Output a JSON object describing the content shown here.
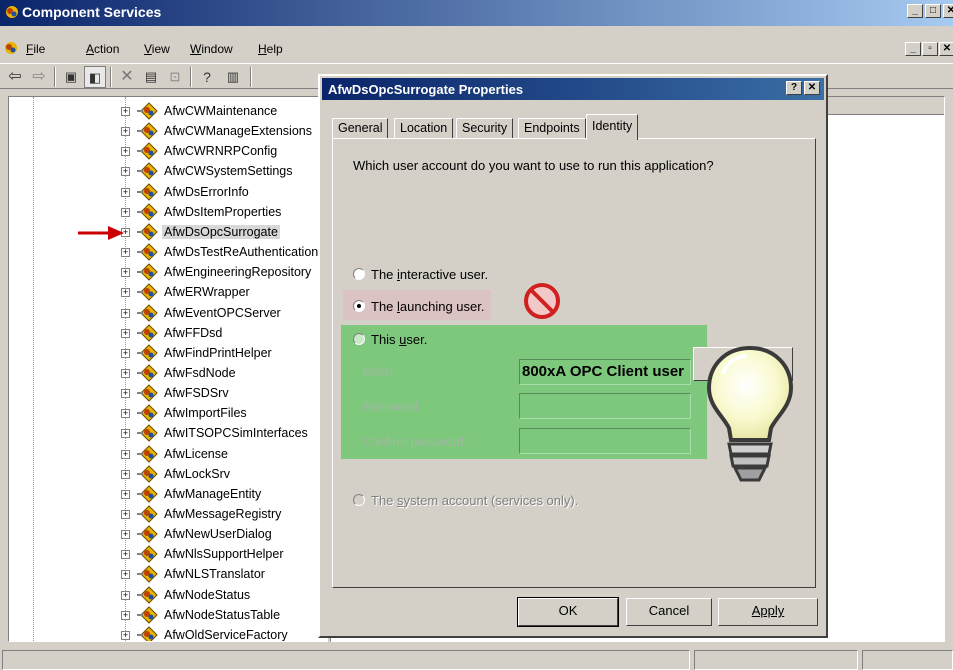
{
  "window": {
    "title": "Component Services",
    "controls": [
      "_",
      "□",
      "✕"
    ]
  },
  "menu": {
    "items": [
      {
        "mnemonic": "F",
        "rest": "ile"
      },
      {
        "mnemonic": "A",
        "rest": "ction"
      },
      {
        "mnemonic": "V",
        "rest": "iew"
      },
      {
        "mnemonic": "W",
        "rest": "indow"
      },
      {
        "mnemonic": "H",
        "rest": "elp"
      }
    ],
    "mdi_controls": [
      "_",
      "▫",
      "✕"
    ]
  },
  "toolbar": {
    "icons": [
      "back-icon",
      "forward-icon",
      "up-folder-icon",
      "show-tree-icon",
      "delete-icon",
      "properties-icon",
      "refresh-icon",
      "help-icon",
      "console-icon"
    ]
  },
  "tree": {
    "items": [
      {
        "label": "AfwCWMaintenance"
      },
      {
        "label": "AfwCWManageExtensions"
      },
      {
        "label": "AfwCWRNRPConfig"
      },
      {
        "label": "AfwCWSystemSettings"
      },
      {
        "label": "AfwDsErrorInfo"
      },
      {
        "label": "AfwDsItemProperties"
      },
      {
        "label": "AfwDsOpcSurrogate"
      },
      {
        "label": "AfwDsTestReAuthentication"
      },
      {
        "label": "AfwEngineeringRepository"
      },
      {
        "label": "AfwERWrapper"
      },
      {
        "label": "AfwEventOPCServer"
      },
      {
        "label": "AfwFFDsd"
      },
      {
        "label": "AfwFindPrintHelper"
      },
      {
        "label": "AfwFsdNode"
      },
      {
        "label": "AfwFSDSrv"
      },
      {
        "label": "AfwImportFiles"
      },
      {
        "label": "AfwITSOPCSimInterfaces"
      },
      {
        "label": "AfwLicense"
      },
      {
        "label": "AfwLockSrv"
      },
      {
        "label": "AfwManageEntity"
      },
      {
        "label": "AfwMessageRegistry"
      },
      {
        "label": "AfwNewUserDialog"
      },
      {
        "label": "AfwNlsSupportHelper"
      },
      {
        "label": "AfwNLSTranslator"
      },
      {
        "label": "AfwNodeStatus"
      },
      {
        "label": "AfwNodeStatusTable"
      },
      {
        "label": "AfwOldServiceFactory"
      }
    ],
    "selected": "AfwDsOpcSurrogate"
  },
  "dialog": {
    "title": "AfwDsOpcSurrogate Properties",
    "title_buttons": [
      "?",
      "✕"
    ],
    "tabs": [
      {
        "label": "General",
        "active": false
      },
      {
        "label": "Location",
        "active": false
      },
      {
        "label": "Security",
        "active": false
      },
      {
        "label": "Endpoints",
        "active": false
      },
      {
        "label": "Identity",
        "active": true
      }
    ],
    "question": "Which user account do you want to use to run this application?",
    "options": {
      "interactive": {
        "pre": "The ",
        "mnemonic": "i",
        "post": "nteractive user."
      },
      "launching": {
        "pre": "The ",
        "mnemonic": "l",
        "post": "aunching user."
      },
      "this_user": {
        "pre": "This ",
        "mnemonic": "u",
        "post": "ser."
      },
      "system": {
        "pre": "The ",
        "mnemonic": "s",
        "post": "ystem account (services only)."
      }
    },
    "selected_option": "launching",
    "fields": {
      "user_label": "User:",
      "user_value": "800xA OPC Client user",
      "password_label": "Password:",
      "password_value": "",
      "confirm_label": "Confirm password:",
      "confirm_value": ""
    },
    "buttons": {
      "ok": "OK",
      "cancel": "Cancel",
      "apply": "Apply"
    }
  },
  "colors": {
    "title_bar": "#0a246a",
    "highlight_green": "#7ec87e",
    "highlight_pink": "#dcc3c3",
    "arrow_red": "#cc0000"
  }
}
